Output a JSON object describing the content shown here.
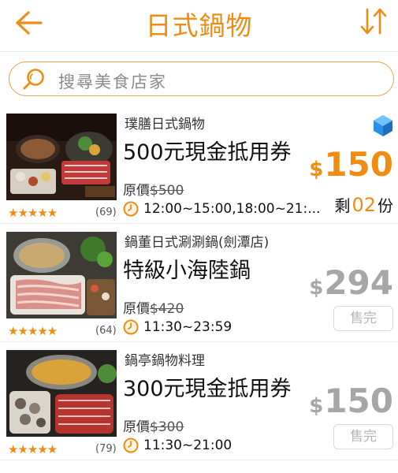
{
  "header": {
    "title": "日式鍋物",
    "back_icon": "back-arrow-icon",
    "sort_icon": "sort-arrows-icon",
    "accent_color": "#f08c12"
  },
  "search": {
    "placeholder": "搜尋美食店家",
    "icon": "search-icon"
  },
  "deals": [
    {
      "shop": "璞膳日式鍋物",
      "title": "500元現金抵用券",
      "orig_label": "原價",
      "orig_price": "$500",
      "stars": "★★★★★",
      "reviews": "(69)",
      "hours": "12:00~15:00,18:00~21:...",
      "price_currency": "$",
      "price": "150",
      "remain_prefix": "剩",
      "remain_qty": "02",
      "remain_suffix": "份",
      "badge_icon": "blue-cube-icon"
    },
    {
      "shop": "鍋董日式涮涮鍋(劍潭店)",
      "title": "特級小海陸鍋",
      "orig_label": "原價",
      "orig_price": "$420",
      "stars": "★★★★★",
      "reviews": "(64)",
      "hours": "11:30~23:59",
      "price_currency": "$",
      "price": "294",
      "sold_label": "售完"
    },
    {
      "shop": "鍋亭鍋物料理",
      "title": "300元現金抵用券",
      "orig_label": "原價",
      "orig_price": "$300",
      "stars": "★★★★★",
      "reviews": "(79)",
      "hours": "11:30~21:00",
      "price_currency": "$",
      "price": "150",
      "sold_label": "售完"
    }
  ]
}
